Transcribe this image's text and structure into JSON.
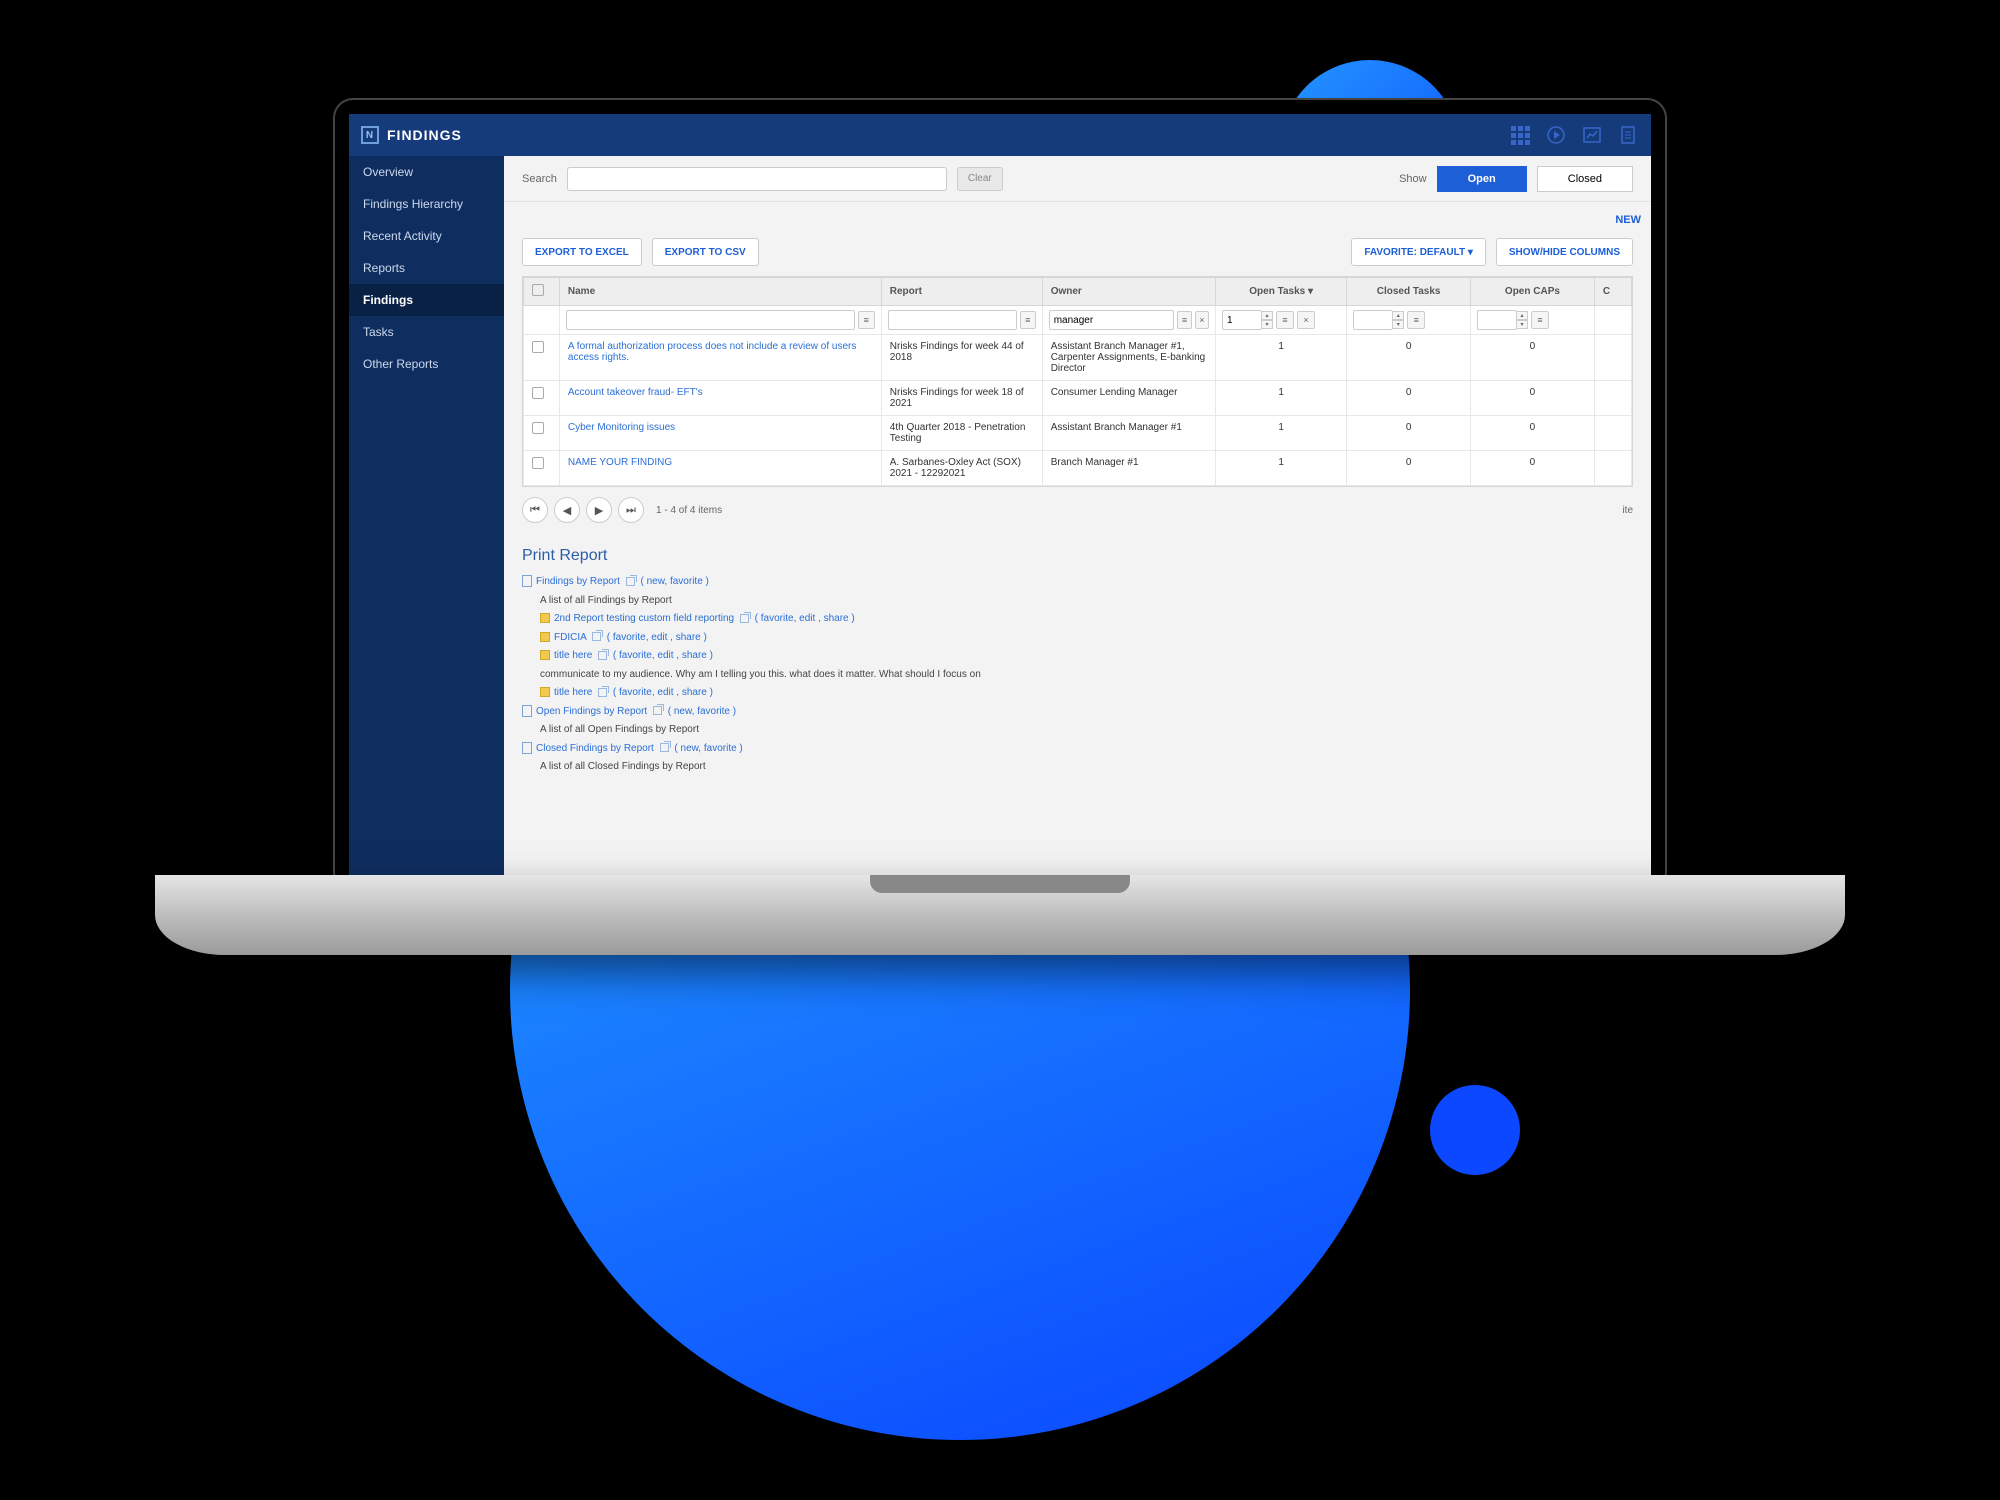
{
  "topbar": {
    "title": "FINDINGS"
  },
  "sidebar": {
    "items": [
      {
        "label": "Overview"
      },
      {
        "label": "Findings Hierarchy"
      },
      {
        "label": "Recent Activity"
      },
      {
        "label": "Reports"
      },
      {
        "label": "Findings"
      },
      {
        "label": "Tasks"
      },
      {
        "label": "Other Reports"
      }
    ]
  },
  "search": {
    "label": "Search",
    "clear": "Clear",
    "show": "Show",
    "open": "Open",
    "closed": "Closed",
    "new": "NEW"
  },
  "export": {
    "excel": "EXPORT TO EXCEL",
    "csv": "EXPORT TO CSV",
    "fav": "FAVORITE: DEFAULT ▾",
    "cols": "SHOW/HIDE COLUMNS"
  },
  "columns": {
    "name": "Name",
    "report": "Report",
    "owner": "Owner",
    "opentasks": "Open Tasks ▾",
    "closedtasks": "Closed Tasks",
    "opencaps": "Open CAPs",
    "last": "C"
  },
  "filters": {
    "owner": "manager",
    "opentasks": "1"
  },
  "rows": [
    {
      "name": "A formal authorization process does not include a review of users access rights.",
      "report": "Nrisks Findings for week 44 of 2018",
      "owner": "Assistant Branch Manager #1, Carpenter Assignments, E-banking Director",
      "open": "1",
      "closed": "0",
      "caps": "0"
    },
    {
      "name": "Account takeover fraud- EFT's",
      "report": "Nrisks Findings for week 18 of 2021",
      "owner": "Consumer Lending Manager",
      "open": "1",
      "closed": "0",
      "caps": "0"
    },
    {
      "name": "Cyber Monitoring issues",
      "report": "4th Quarter 2018 - Penetration Testing",
      "owner": "Assistant Branch Manager #1",
      "open": "1",
      "closed": "0",
      "caps": "0"
    },
    {
      "name": "NAME YOUR FINDING",
      "report": "A. Sarbanes-Oxley Act (SOX) 2021 - 12292021",
      "owner": "Branch Manager #1",
      "open": "1",
      "closed": "0",
      "caps": "0"
    }
  ],
  "pager": {
    "range": "1 - 4 of 4 items",
    "ite": "ite"
  },
  "print": {
    "title": "Print Report",
    "groups": [
      {
        "title": "Findings by Report",
        "actions": "( new, favorite )",
        "desc": "A list of all Findings by Report",
        "children": [
          {
            "title": "2nd Report testing custom field reporting",
            "actions": "( favorite, edit , share )"
          },
          {
            "title": "FDICIA",
            "actions": "( favorite, edit , share )"
          },
          {
            "title": "title here",
            "actions": "( favorite, edit , share )",
            "desc": "communicate to my audience. Why am I telling you this. what does it matter. What should I focus on"
          },
          {
            "title": "title here",
            "actions": "( favorite, edit , share )"
          }
        ]
      },
      {
        "title": "Open Findings by Report",
        "actions": "( new, favorite )",
        "desc": "A list of all Open Findings by Report"
      },
      {
        "title": "Closed Findings by Report",
        "actions": "( new, favorite )",
        "desc": "A list of all Closed Findings by Report"
      }
    ]
  }
}
